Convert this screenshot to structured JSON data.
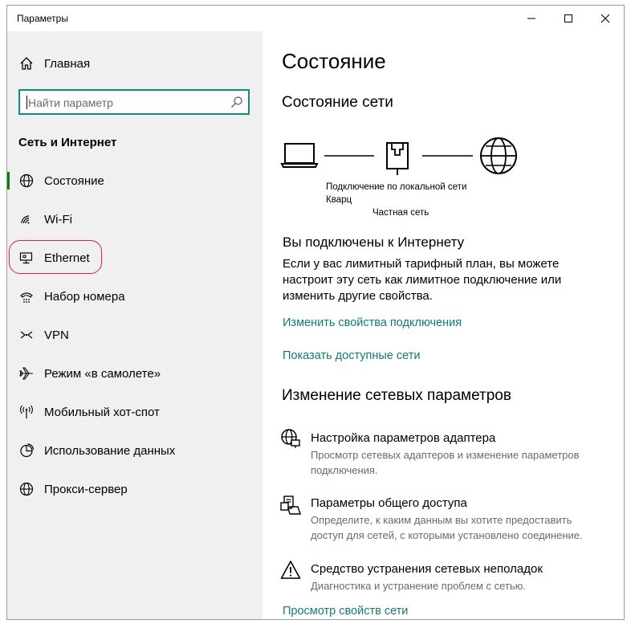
{
  "window": {
    "title": "Параметры",
    "controls": [
      "minimize",
      "maximize",
      "close"
    ]
  },
  "sidebar": {
    "home_label": "Главная",
    "search_placeholder": "Найти параметр",
    "section_title": "Сеть и Интернет",
    "items": [
      {
        "label": "Состояние",
        "icon": "globe-icon",
        "active": true
      },
      {
        "label": "Wi-Fi",
        "icon": "wifi-icon"
      },
      {
        "label": "Ethernet",
        "icon": "ethernet-icon",
        "highlighted": true
      },
      {
        "label": "Набор номера",
        "icon": "dialup-icon"
      },
      {
        "label": "VPN",
        "icon": "vpn-icon"
      },
      {
        "label": "Режим «в самолете»",
        "icon": "airplane-icon"
      },
      {
        "label": "Мобильный хот-спот",
        "icon": "hotspot-icon"
      },
      {
        "label": "Использование данных",
        "icon": "data-usage-icon"
      },
      {
        "label": "Прокси-сервер",
        "icon": "proxy-globe-icon"
      }
    ],
    "accent_color": "#107c10",
    "highlight_color": "#e0212b"
  },
  "main": {
    "page_title": "Состояние",
    "network_status_heading": "Состояние сети",
    "diagram": {
      "connection_name": "Подключение по локальной сети",
      "network_name": "Кварц",
      "network_type": "Частная сеть"
    },
    "connected_heading": "Вы подключены к Интернету",
    "connected_text": "Если у вас лимитный тарифный план, вы можете настроит эту сеть как лимитное подключение или изменить другие свойства.",
    "link_change_properties": "Изменить свойства подключения",
    "link_show_networks": "Показать доступные сети",
    "change_settings_heading": "Изменение сетевых параметров",
    "options": [
      {
        "title": "Настройка параметров адаптера",
        "desc": "Просмотр сетевых адаптеров и изменение параметров подключения.",
        "icon": "adapter-icon"
      },
      {
        "title": "Параметры общего доступа",
        "desc": "Определите, к каким данным вы хотите предоставить доступ для сетей, с которыми установлено соединение.",
        "icon": "sharing-icon"
      },
      {
        "title": "Средство устранения сетевых неполадок",
        "desc": "Диагностика и устранение проблем с сетью.",
        "icon": "warning-icon"
      }
    ],
    "link_view_properties": "Просмотр свойств сети",
    "link_color": "#107c6d"
  }
}
